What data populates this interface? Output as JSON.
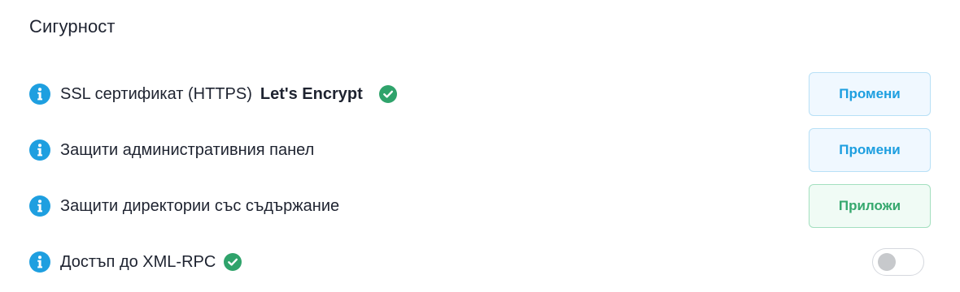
{
  "section": {
    "title": "Сигурност"
  },
  "rows": [
    {
      "label": "SSL сертификат (HTTPS)",
      "strong": "Let's Encrypt",
      "status_icon": "check-circle-icon",
      "action_label": "Промени",
      "action_color": "#1e9fe0"
    },
    {
      "label": "Защити административния панел",
      "action_label": "Промени",
      "action_color": "#1e9fe0"
    },
    {
      "label": "Защити директории със съдържание",
      "action_label": "Приложи",
      "action_color": "#36a86e"
    },
    {
      "label": "Достъп до XML-RPC",
      "status_icon": "check-circle-icon",
      "toggle_on": false
    }
  ],
  "colors": {
    "info_icon": "#1e9fe0",
    "check_icon": "#2fa36b",
    "text": "#1e2330"
  }
}
